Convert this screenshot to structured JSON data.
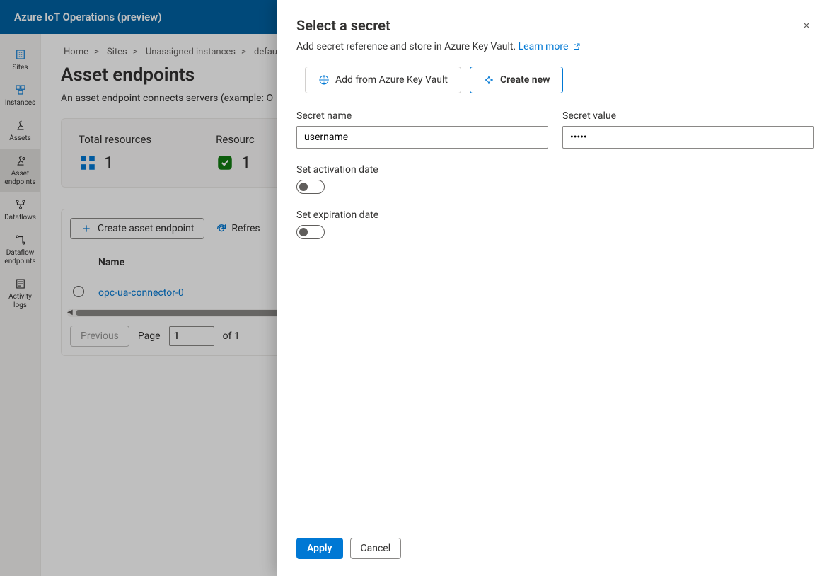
{
  "topbar": {
    "title": "Azure IoT Operations (preview)"
  },
  "sidenav": {
    "sites": "Sites",
    "instances": "Instances",
    "assets": "Assets",
    "asset_endpoints": "Asset endpoints",
    "dataflows": "Dataflows",
    "dataflow_endpoints": "Dataflow endpoints",
    "activity_logs": "Activity logs"
  },
  "breadcrumb": {
    "home": "Home",
    "sites": "Sites",
    "unassigned": "Unassigned instances",
    "default": "default"
  },
  "page": {
    "title": "Asset endpoints",
    "subtitle": "An asset endpoint connects servers (example: O"
  },
  "stats": {
    "total_label": "Total resources",
    "total_value": "1",
    "res_label": "Resourc",
    "res_value": "1"
  },
  "toolbar": {
    "create": "Create asset endpoint",
    "refresh": "Refres"
  },
  "table": {
    "col_name": "Name",
    "row1": "opc-ua-connector-0"
  },
  "pager": {
    "previous": "Previous",
    "page_label": "Page",
    "page_value": "1",
    "of": "of 1"
  },
  "panel": {
    "title": "Select a secret",
    "subtitle": "Add secret reference and store in Azure Key Vault. ",
    "learn_more": "Learn more",
    "add_keyvault": "Add from Azure Key Vault",
    "create_new": "Create new",
    "secret_name_label": "Secret name",
    "secret_name_value": "username",
    "secret_value_label": "Secret value",
    "secret_value_value": "•••••",
    "activation": "Set activation date",
    "expiration": "Set expiration date",
    "apply": "Apply",
    "cancel": "Cancel"
  }
}
